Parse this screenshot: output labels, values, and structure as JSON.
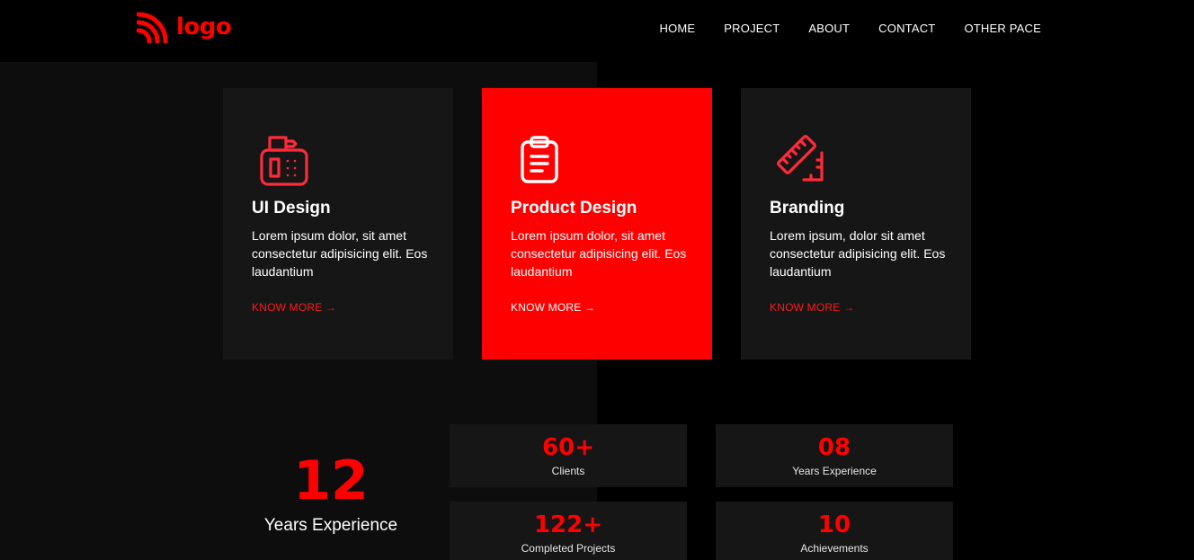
{
  "brand": {
    "name": "logo",
    "accent": "#ff0000"
  },
  "nav": {
    "items": [
      "HOME",
      "PROJECT",
      "ABOUT",
      "CONTACT",
      "OTHER PACE"
    ]
  },
  "services": [
    {
      "icon": "fax-machine-icon",
      "title": "UI Design",
      "text": "Lorem ipsum dolor, sit amet consectetur adipisicing elit. Eos laudantium",
      "link": "KNOW MORE →"
    },
    {
      "icon": "clipboard-icon",
      "title": "Product Design",
      "text": "Lorem ipsum dolor, sit amet consectetur adipisicing elit. Eos laudantium",
      "link": "KNOW MORE →"
    },
    {
      "icon": "ruler-icon",
      "title": "Branding",
      "text": "Lorem ipsum, dolor sit amet consectetur adipisicing elit. Eos laudantium",
      "link": "KNOW MORE →"
    }
  ],
  "experience": {
    "value": "12",
    "label": "Years Experience"
  },
  "stats": [
    {
      "value": "60+",
      "label": "Clients"
    },
    {
      "value": "08",
      "label": "Years Experience"
    },
    {
      "value": "122+",
      "label": "Completed Projects"
    },
    {
      "value": "10",
      "label": "Achievements"
    }
  ]
}
